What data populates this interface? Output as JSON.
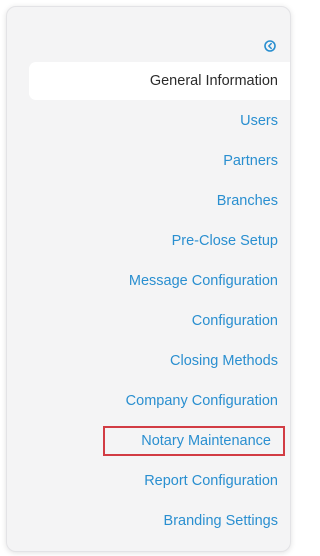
{
  "sidebar": {
    "collapse_icon": "arrow-circle-left-icon",
    "accent_color": "#2a8fd0",
    "highlight_color": "#d23c44",
    "items": [
      {
        "label": "General Information",
        "active": true
      },
      {
        "label": "Users"
      },
      {
        "label": "Partners"
      },
      {
        "label": "Branches"
      },
      {
        "label": "Pre-Close Setup"
      },
      {
        "label": "Message Configuration"
      },
      {
        "label": "Configuration"
      },
      {
        "label": "Closing Methods"
      },
      {
        "label": "Company Configuration"
      },
      {
        "label": "Notary Maintenance",
        "highlighted": true
      },
      {
        "label": "Report Configuration"
      },
      {
        "label": "Branding Settings"
      }
    ]
  }
}
